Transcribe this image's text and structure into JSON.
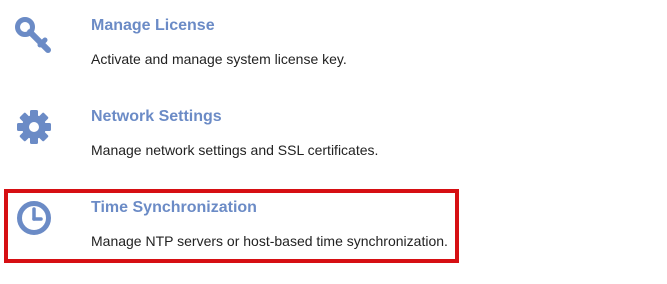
{
  "settings": {
    "items": [
      {
        "icon": "key-icon",
        "title": "Manage License",
        "description": "Activate and manage system license key."
      },
      {
        "icon": "gear-icon",
        "title": "Network Settings",
        "description": "Manage network settings and SSL certificates."
      },
      {
        "icon": "clock-icon",
        "title": "Time Synchronization",
        "description": "Manage NTP servers or host-based time synchronization."
      }
    ]
  },
  "colors": {
    "accent": "#6b8bc6",
    "text": "#222222",
    "highlight": "#d60f13"
  },
  "highlight": {
    "target": "Time Synchronization"
  }
}
